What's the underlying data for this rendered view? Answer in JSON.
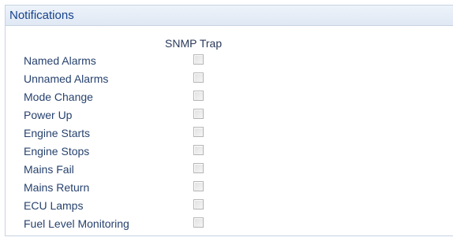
{
  "panel": {
    "title": "Notifications"
  },
  "table": {
    "column_header": "SNMP Trap",
    "rows": [
      {
        "label": "Named Alarms",
        "checked": false
      },
      {
        "label": "Unnamed Alarms",
        "checked": false
      },
      {
        "label": "Mode Change",
        "checked": false
      },
      {
        "label": "Power Up",
        "checked": false
      },
      {
        "label": "Engine Starts",
        "checked": false
      },
      {
        "label": "Engine Stops",
        "checked": false
      },
      {
        "label": "Mains Fail",
        "checked": false
      },
      {
        "label": "Mains Return",
        "checked": false
      },
      {
        "label": "ECU Lamps",
        "checked": false
      },
      {
        "label": "Fuel Level Monitoring",
        "checked": false
      }
    ]
  }
}
